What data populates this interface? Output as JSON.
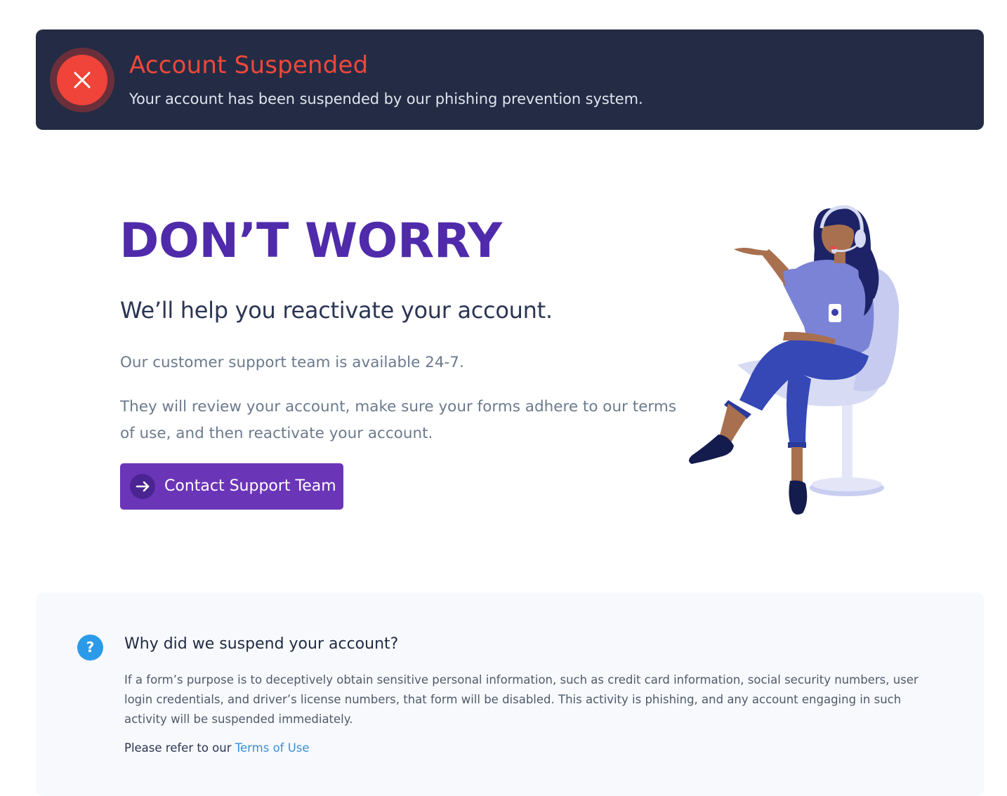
{
  "alert": {
    "icon": "close-icon",
    "title": "Account Suspended",
    "message": "Your account has been suspended by our phishing prevention system.",
    "title_color": "#f2473b",
    "background": "#232c44"
  },
  "hero": {
    "title": "DON’T WORRY",
    "subtitle": "We’ll help you reactivate your account.",
    "availability": "Our customer support team is available 24-7.",
    "description": "They will review your account, make sure your forms adhere to our terms of use, and then reactivate your account.",
    "cta": {
      "label": "Contact Support Team",
      "icon": "arrow-right-icon"
    },
    "accent_color": "#4f2bab",
    "illustration": "support-agent-illustration"
  },
  "faq": {
    "icon": "question-icon",
    "icon_glyph": "?",
    "question": "Why did we suspend your account?",
    "answer": "If a form’s purpose is to deceptively obtain sensitive personal information, such as credit card information, social security numbers, user login credentials, and driver’s license numbers, that form will be disabled. This activity is phishing, and any account engaging in such activity will be suspended immediately.",
    "refer_prefix": "Please refer to our ",
    "refer_link": "Terms of Use",
    "link_color": "#3a8fd8"
  }
}
